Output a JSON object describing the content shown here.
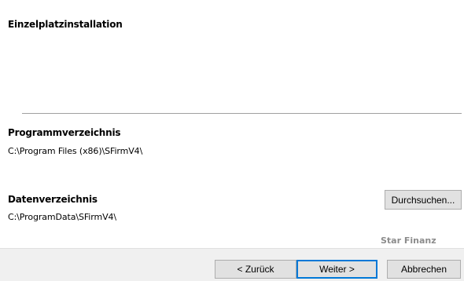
{
  "sections": {
    "install_type": {
      "title": "Einzelplatzinstallation"
    },
    "program_dir": {
      "title": "Programmverzeichnis",
      "path": "C:\\Program Files (x86)\\SFirmV4\\"
    },
    "data_dir": {
      "title": "Datenverzeichnis",
      "path": "C:\\ProgramData\\SFirmV4\\",
      "browse_label": "Durchsuchen..."
    }
  },
  "brand": {
    "text": "Star Finanz"
  },
  "footer": {
    "back_label": "< Zurück",
    "next_label": "Weiter >",
    "cancel_label": "Abbrechen"
  },
  "colors": {
    "content_bg": "#ffffff",
    "window_bg": "#f0f0f0",
    "default_button_border": "#0078d7",
    "brand_text": "#8c8c8c"
  }
}
